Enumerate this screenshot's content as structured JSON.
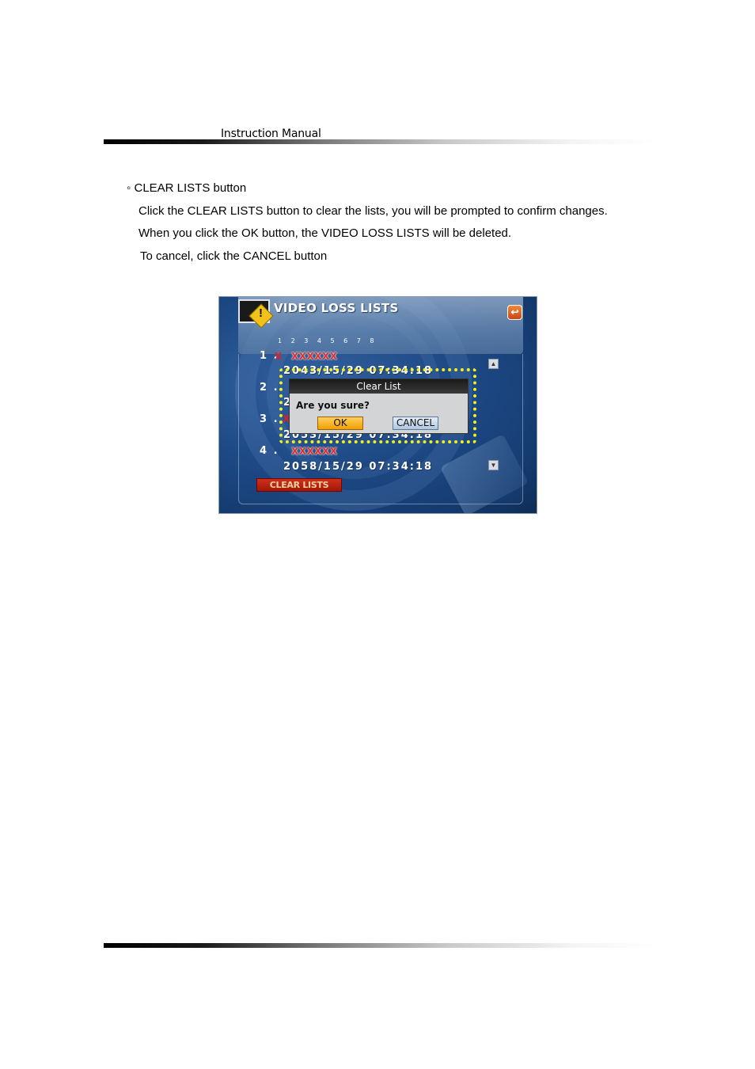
{
  "header": {
    "label": "Instruction Manual"
  },
  "content": {
    "section_title": "◦ CLEAR LISTS button",
    "paragraphs": [
      "Click the CLEAR LISTS button to clear the lists, you will be prompted to confirm changes.",
      "When you click the OK button, the VIDEO LOSS LISTS will be deleted.",
      "To cancel, click the CANCEL button"
    ]
  },
  "screen": {
    "title": "VIDEO LOSS LISTS",
    "channels": "1 2 3 4 5 6 7 8",
    "rows": [
      {
        "num": "1 .",
        "mark": "X",
        "xs": "XXXXXX",
        "timestamp": "2043/15/29  07:34:18"
      },
      {
        "num": "2 .",
        "mark": "",
        "xs": "",
        "timestamp": "2"
      },
      {
        "num": "3 .",
        "mark": "X",
        "xs": "",
        "timestamp": "2053/15/29  07:34:18"
      },
      {
        "num": "4 .",
        "mark": "",
        "xs": "XXXXXX",
        "timestamp": "2058/15/29  07:34:18"
      }
    ],
    "clear_button": "CLEAR LISTS",
    "dialog": {
      "title": "Clear List",
      "question": "Are you sure?",
      "ok": "OK",
      "cancel": "CANCEL"
    },
    "colors": {
      "accent": "#f0f020",
      "danger": "#c0250f",
      "ok": "#f0a000"
    }
  }
}
